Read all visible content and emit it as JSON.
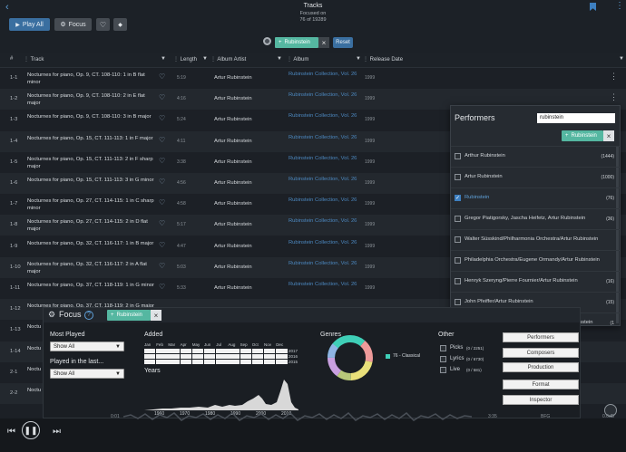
{
  "header": {
    "title": "Tracks",
    "subtitle": "Focused on",
    "count": "76 of 19289"
  },
  "toolbar": {
    "play_all": "Play All",
    "focus": "Focus"
  },
  "filter": {
    "chip": "Rubinstein",
    "reset": "Reset"
  },
  "columns": [
    "#",
    "Track",
    "Length",
    "Album Artist",
    "Album",
    "Release Date"
  ],
  "rows": [
    {
      "num": "1-1",
      "title": "Nocturnes for piano, Op. 9, CT. 108-110: 1 in B flat minor",
      "length": "5:19",
      "artist": "Artur Rubinstein",
      "album": "Rubinstein Collection, Vol. 26",
      "date": "1999"
    },
    {
      "num": "1-2",
      "title": "Nocturnes for piano, Op. 9, CT. 108-110: 2 in E flat major",
      "length": "4:16",
      "artist": "Artur Rubinstein",
      "album": "Rubinstein Collection, Vol. 26",
      "date": "1999"
    },
    {
      "num": "1-3",
      "title": "Nocturnes for piano, Op. 9, CT. 108-110: 3 in B major",
      "length": "5:24",
      "artist": "Artur Rubinstein",
      "album": "Rubinstein Collection, Vol. 26",
      "date": "1999"
    },
    {
      "num": "1-4",
      "title": "Nocturnes for piano, Op. 15, CT. 111-113: 1 in F major",
      "length": "4:11",
      "artist": "Artur Rubinstein",
      "album": "Rubinstein Collection, Vol. 26",
      "date": "1999"
    },
    {
      "num": "1-5",
      "title": "Nocturnes for piano, Op. 15, CT. 111-113: 2 in F sharp major",
      "length": "3:38",
      "artist": "Artur Rubinstein",
      "album": "Rubinstein Collection, Vol. 26",
      "date": "1999"
    },
    {
      "num": "1-6",
      "title": "Nocturnes for piano, Op. 15, CT. 111-113: 3 in G minor",
      "length": "4:56",
      "artist": "Artur Rubinstein",
      "album": "Rubinstein Collection, Vol. 26",
      "date": "1999"
    },
    {
      "num": "1-7",
      "title": "Nocturnes for piano, Op. 27, CT. 114-115: 1 in C sharp minor",
      "length": "4:58",
      "artist": "Artur Rubinstein",
      "album": "Rubinstein Collection, Vol. 26",
      "date": "1999"
    },
    {
      "num": "1-8",
      "title": "Nocturnes for piano, Op. 27, CT. 114-115: 2 in D flat major",
      "length": "5:17",
      "artist": "Artur Rubinstein",
      "album": "Rubinstein Collection, Vol. 26",
      "date": "1999"
    },
    {
      "num": "1-9",
      "title": "Nocturnes for piano, Op. 32, CT. 116-117: 1 in B major",
      "length": "4:47",
      "artist": "Artur Rubinstein",
      "album": "Rubinstein Collection, Vol. 26",
      "date": "1999"
    },
    {
      "num": "1-10",
      "title": "Nocturnes for piano, Op. 32, CT. 116-117: 2 in A flat major",
      "length": "5:03",
      "artist": "Artur Rubinstein",
      "album": "Rubinstein Collection, Vol. 26",
      "date": "1999"
    },
    {
      "num": "1-11",
      "title": "Nocturnes for piano, Op. 37, CT. 118-119: 1 in G minor",
      "length": "5:33",
      "artist": "Artur Rubinstein",
      "album": "Rubinstein Collection, Vol. 26",
      "date": "1999"
    },
    {
      "num": "1-12",
      "title": "Nocturnes for piano, Op. 37, CT. 118-119: 2 in G major",
      "length": "",
      "artist": "",
      "album": "",
      "date": ""
    },
    {
      "num": "1-13",
      "title": "Noctu",
      "length": "",
      "artist": "",
      "album": "",
      "date": ""
    },
    {
      "num": "1-14",
      "title": "Noctu sharp",
      "length": "",
      "artist": "",
      "album": "",
      "date": ""
    },
    {
      "num": "2-1",
      "title": "Noctu",
      "length": "",
      "artist": "",
      "album": "",
      "date": ""
    },
    {
      "num": "2-2",
      "title": "Noctu flat m",
      "length": "",
      "artist": "",
      "album": "",
      "date": ""
    }
  ],
  "performers": {
    "title": "Performers",
    "search_value": "rubinstein",
    "chip": "Rubinstein",
    "items": [
      {
        "name": "Arthur Rubinstein",
        "count": "(1444)",
        "checked": false
      },
      {
        "name": "Artur Rubinstein",
        "count": "(1000)",
        "checked": false
      },
      {
        "name": "Rubinstein",
        "count": "(76)",
        "checked": true
      },
      {
        "name": "Gregor Piatigorsky, Jascha Heifetz, Artur Rubinstein",
        "count": "(36)",
        "checked": false
      },
      {
        "name": "Walter Süsskind/Philharmonia Orchestra/Artur Rubinstein",
        "count": "",
        "checked": false
      },
      {
        "name": "Philadelphia Orchestra/Eugene Ormandy/Artur Rubinstein",
        "count": "",
        "checked": false
      },
      {
        "name": "Henryk Szeryng/Pierre Fournier/Artur Rubinstein",
        "count": "(16)",
        "checked": false
      },
      {
        "name": "John Pfeiffer/Artur Rubinstein",
        "count": "(15)",
        "checked": false
      },
      {
        "name": "Michael Tree/David Soyer/John Dalley/Artur Rubinstein",
        "count": "(1",
        "checked": false
      }
    ]
  },
  "focus": {
    "title": "Focus",
    "chip": "Rubinstein",
    "most_played_label": "Most Played",
    "most_played_value": "Show All",
    "played_last_label": "Played in the last...",
    "played_last_value": "Show All",
    "added_label": "Added",
    "months": [
      "Jan",
      "Feb",
      "Mar",
      "Apr",
      "May",
      "Jun",
      "Jul",
      "Aug",
      "Sep",
      "Oct",
      "Nov",
      "Dec"
    ],
    "added_years": [
      "2017",
      "2016",
      "2015"
    ],
    "years_label": "Years",
    "decade_ticks": [
      "1960",
      "1970",
      "1980",
      "1990",
      "2000",
      "2010"
    ],
    "genres_label": "Genres",
    "genre_legend": "76 - Classical",
    "other_label": "Other",
    "other_items": [
      {
        "label": "Picks",
        "count": "(0 / 2251)"
      },
      {
        "label": "Lyrics",
        "count": "(0 / 6730)"
      },
      {
        "label": "Live",
        "count": "(0 / 581)"
      }
    ],
    "side_buttons": [
      "Performers",
      "Composers",
      "Production",
      "Format",
      "Inspector"
    ]
  },
  "player": {
    "elapsed": "0:01",
    "total": "3:35",
    "bfg": "BFG",
    "volume": "0.0dB"
  },
  "colors": {
    "accent": "#55b7a1",
    "link": "#4c88c0",
    "primary_button": "#3a6fa0",
    "genre_main": "#3fcfb7"
  }
}
